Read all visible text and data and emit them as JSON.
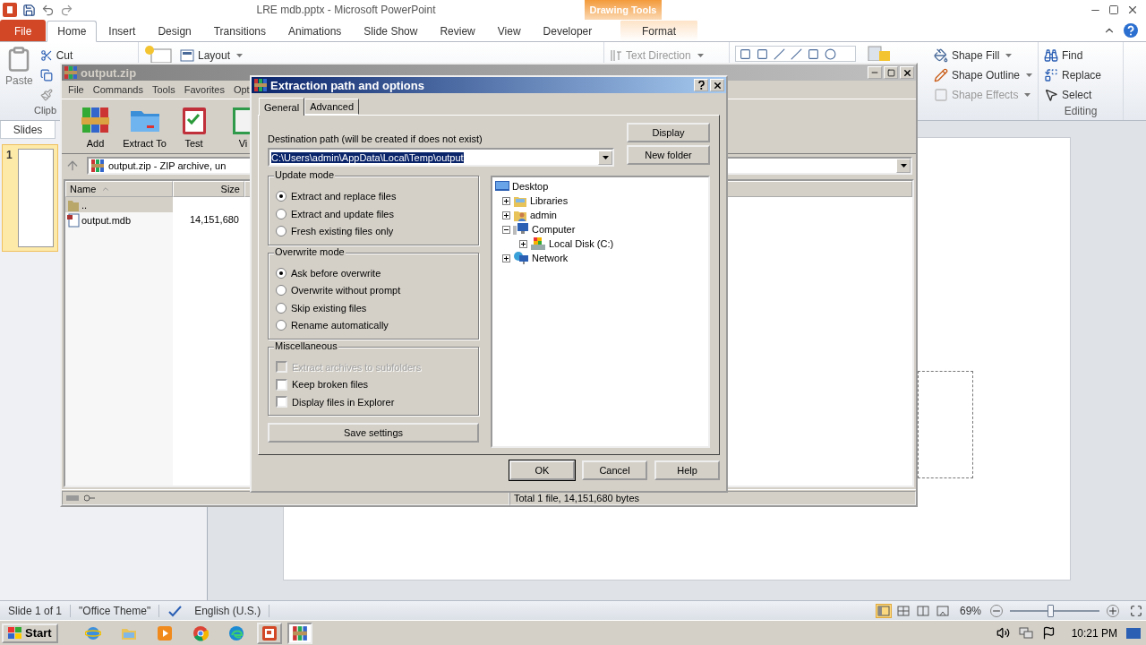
{
  "powerpoint": {
    "title": "LRE mdb.pptx - Microsoft PowerPoint",
    "contextual_group": "Drawing Tools",
    "tabs": [
      {
        "label": "File",
        "kind": "file",
        "selected": false
      },
      {
        "label": "Home",
        "kind": "standard",
        "selected": true
      },
      {
        "label": "Insert",
        "kind": "standard",
        "selected": false
      },
      {
        "label": "Design",
        "kind": "standard",
        "selected": false
      },
      {
        "label": "Transitions",
        "kind": "standard",
        "selected": false
      },
      {
        "label": "Animations",
        "kind": "standard",
        "selected": false
      },
      {
        "label": "Slide Show",
        "kind": "standard",
        "selected": false
      },
      {
        "label": "Review",
        "kind": "standard",
        "selected": false
      },
      {
        "label": "View",
        "kind": "standard",
        "selected": false
      },
      {
        "label": "Developer",
        "kind": "standard",
        "selected": false
      },
      {
        "label": "Format",
        "kind": "contextual",
        "selected": false
      }
    ],
    "ribbon": {
      "paste": "Paste",
      "cut": "Cut",
      "clipboard_group": "Clipb",
      "layout": "Layout",
      "text_direction": "Text Direction",
      "shape_commands": [
        {
          "kind": "fill",
          "label": "Shape Fill",
          "disabled": false
        },
        {
          "kind": "outline",
          "label": "Shape Outline",
          "disabled": false
        },
        {
          "kind": "effects",
          "label": "Shape Effects",
          "disabled": true
        }
      ],
      "editing_commands": [
        {
          "kind": "find",
          "label": "Find"
        },
        {
          "kind": "replace",
          "label": "Replace"
        },
        {
          "kind": "select",
          "label": "Select"
        }
      ],
      "editing_group": "Editing"
    },
    "slides_pane": {
      "tab": "Slides",
      "slides": [
        {
          "number": "1",
          "selected": true
        }
      ]
    },
    "status_bar": {
      "slide": "Slide 1 of 1",
      "theme": "\"Office Theme\"",
      "language": "English (U.S.)",
      "views": [
        {
          "kind": "normal",
          "selected": true
        },
        {
          "kind": "sorter",
          "selected": false
        },
        {
          "kind": "reading",
          "selected": false
        },
        {
          "kind": "slideshow",
          "selected": false
        }
      ],
      "zoom": "69%",
      "zoom_slider": {
        "level": 0.45
      }
    }
  },
  "winrar": {
    "title": "output.zip",
    "active": false,
    "menu": [
      "File",
      "Commands",
      "Tools",
      "Favorites",
      "Opt"
    ],
    "toolbar": [
      {
        "kind": "add",
        "label": "Add"
      },
      {
        "kind": "extract",
        "label": "Extract To"
      },
      {
        "kind": "test",
        "label": "Test"
      },
      {
        "kind": "view",
        "label": "Vi"
      }
    ],
    "address": "output.zip - ZIP archive, un",
    "columns": [
      {
        "label": "Name",
        "sorted": true
      },
      {
        "label": "Size",
        "sorted": false
      }
    ],
    "rows": [
      {
        "kind": "folder",
        "name": "..",
        "selected": true
      },
      {
        "kind": "file",
        "name": "output.mdb",
        "size": "14,151,680",
        "selected": false
      }
    ],
    "status": "Total 1 file, 14,151,680 bytes"
  },
  "dialog": {
    "title": "Extraction path and options",
    "tabs": [
      {
        "label": "General",
        "selected": true
      },
      {
        "label": "Advanced",
        "selected": false
      }
    ],
    "destination_label": "Destination path (will be created if does not exist)",
    "destination": {
      "value": "C:\\Users\\admin\\AppData\\Local\\Temp\\output",
      "text_selected": true
    },
    "side_buttons": [
      "Display",
      "New folder"
    ],
    "groups": [
      {
        "title": "Update mode",
        "options": [
          {
            "kind": "radio",
            "label": "Extract and replace files",
            "checked": true,
            "disabled": false
          },
          {
            "kind": "radio",
            "label": "Extract and update files",
            "checked": false,
            "disabled": false
          },
          {
            "kind": "radio",
            "label": "Fresh existing files only",
            "checked": false,
            "disabled": false
          }
        ]
      },
      {
        "title": "Overwrite mode",
        "options": [
          {
            "kind": "radio",
            "label": "Ask before overwrite",
            "checked": true,
            "disabled": false
          },
          {
            "kind": "radio",
            "label": "Overwrite without prompt",
            "checked": false,
            "disabled": false
          },
          {
            "kind": "radio",
            "label": "Skip existing files",
            "checked": false,
            "disabled": false
          },
          {
            "kind": "radio",
            "label": "Rename automatically",
            "checked": false,
            "disabled": false
          }
        ]
      },
      {
        "title": "Miscellaneous",
        "options": [
          {
            "kind": "checkbox",
            "label": "Extract archives to subfolders",
            "checked": false,
            "disabled": true
          },
          {
            "kind": "checkbox",
            "label": "Keep broken files",
            "checked": false,
            "disabled": false
          },
          {
            "kind": "checkbox",
            "label": "Display files in Explorer",
            "checked": false,
            "disabled": false
          }
        ]
      }
    ],
    "save_button": "Save settings",
    "tree": [
      {
        "label": "Desktop",
        "kind": "desktop",
        "children": [
          {
            "label": "Libraries",
            "kind": "libraries",
            "expanded": false
          },
          {
            "label": "admin",
            "kind": "user",
            "expanded": false
          },
          {
            "label": "Computer",
            "kind": "computer",
            "expanded": true,
            "children": [
              {
                "label": "Local Disk (C:)",
                "kind": "disk",
                "expanded": false
              }
            ]
          },
          {
            "label": "Network",
            "kind": "network",
            "expanded": false
          }
        ]
      }
    ],
    "buttons": [
      {
        "label": "OK",
        "default": true
      },
      {
        "label": "Cancel",
        "default": false
      },
      {
        "label": "Help",
        "default": false
      }
    ]
  },
  "taskbar": {
    "start": "Start",
    "quick_launch": [
      {
        "kind": "ie"
      },
      {
        "kind": "explorer"
      },
      {
        "kind": "media"
      },
      {
        "kind": "chrome"
      },
      {
        "kind": "edge"
      }
    ],
    "tasks": [
      {
        "kind": "powerpoint",
        "active": false
      },
      {
        "kind": "winrar",
        "active": true
      }
    ],
    "clock": "10:21 PM"
  }
}
